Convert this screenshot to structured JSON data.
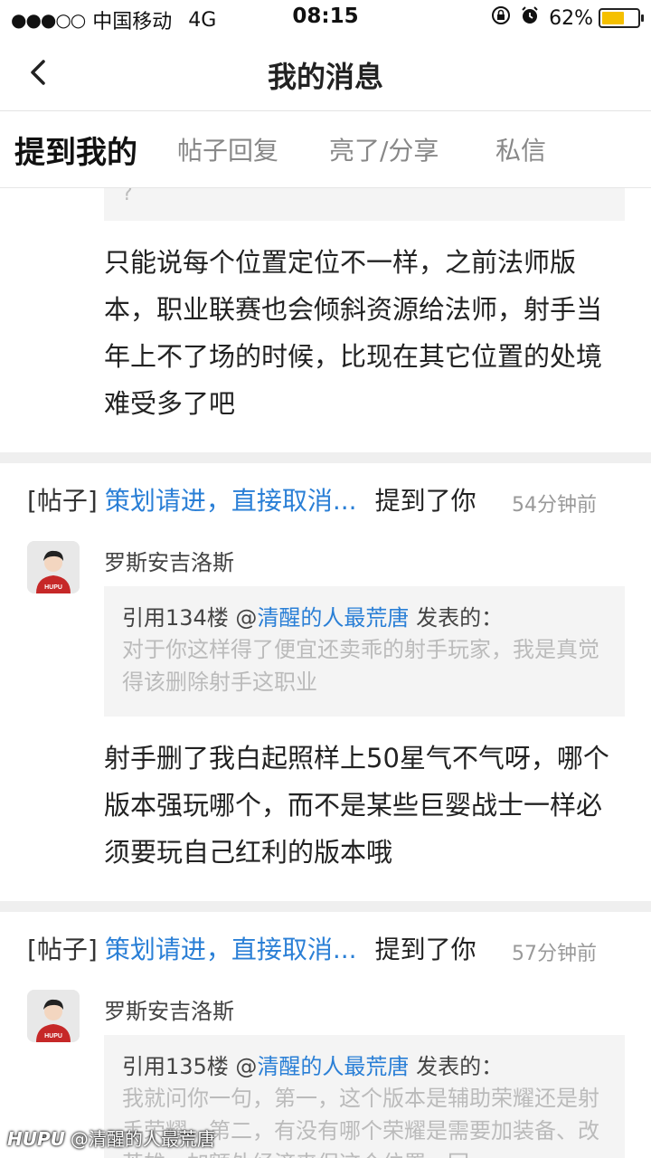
{
  "status": {
    "signal": "●●●○○",
    "carrier": "中国移动",
    "network": "4G",
    "time": "08:15",
    "battery_percent": "62%",
    "battery_level": 0.62
  },
  "nav": {
    "title": "我的消息"
  },
  "tabs": [
    {
      "label": "提到我的",
      "active": true
    },
    {
      "label": "帖子回复",
      "active": false
    },
    {
      "label": "亮了/分享",
      "active": false
    },
    {
      "label": "私信",
      "active": false
    }
  ],
  "first_card": {
    "quote_tail": "?",
    "body": "只能说每个位置定位不一样，之前法师版本，职业联赛也会倾斜资源给法师，射手当年上不了场的时候，比现在其它位置的处境难受多了吧"
  },
  "cards": [
    {
      "tag": "[帖子]",
      "post_title": "策划请进，直接取消...",
      "mention": "提到了你",
      "time": "54分钟前",
      "user": "罗斯安吉洛斯",
      "quote_prefix": "引用134楼 @",
      "quote_user": "清醒的人最荒唐",
      "quote_suffix": " 发表的：",
      "quote_body": "对于你这样得了便宜还卖乖的射手玩家，我是真觉得该删除射手这职业",
      "body": "射手删了我白起照样上50星气不气呀，哪个版本强玩哪个，而不是某些巨婴战士一样必须要玩自己红利的版本哦"
    },
    {
      "tag": "[帖子]",
      "post_title": "策划请进，直接取消...",
      "mention": "提到了你",
      "time": "57分钟前",
      "user": "罗斯安吉洛斯",
      "quote_prefix": "引用135楼 @",
      "quote_user": "清醒的人最荒唐",
      "quote_suffix": " 发表的：",
      "quote_body": "我就问你一句，第一，这个版本是辅助荣耀还是射手荣耀。第二，有没有哪个荣耀是需要加装备、改英雄，加额外经济来保这个位置。回",
      "body": ""
    }
  ],
  "avatar_badge": "HUPU",
  "watermark": {
    "logo": "HUPU",
    "text": "@清醒的人最荒唐"
  },
  "colors": {
    "link": "#2a7fd6",
    "battery": "#f5c000",
    "avatar_shirt": "#c62828"
  }
}
